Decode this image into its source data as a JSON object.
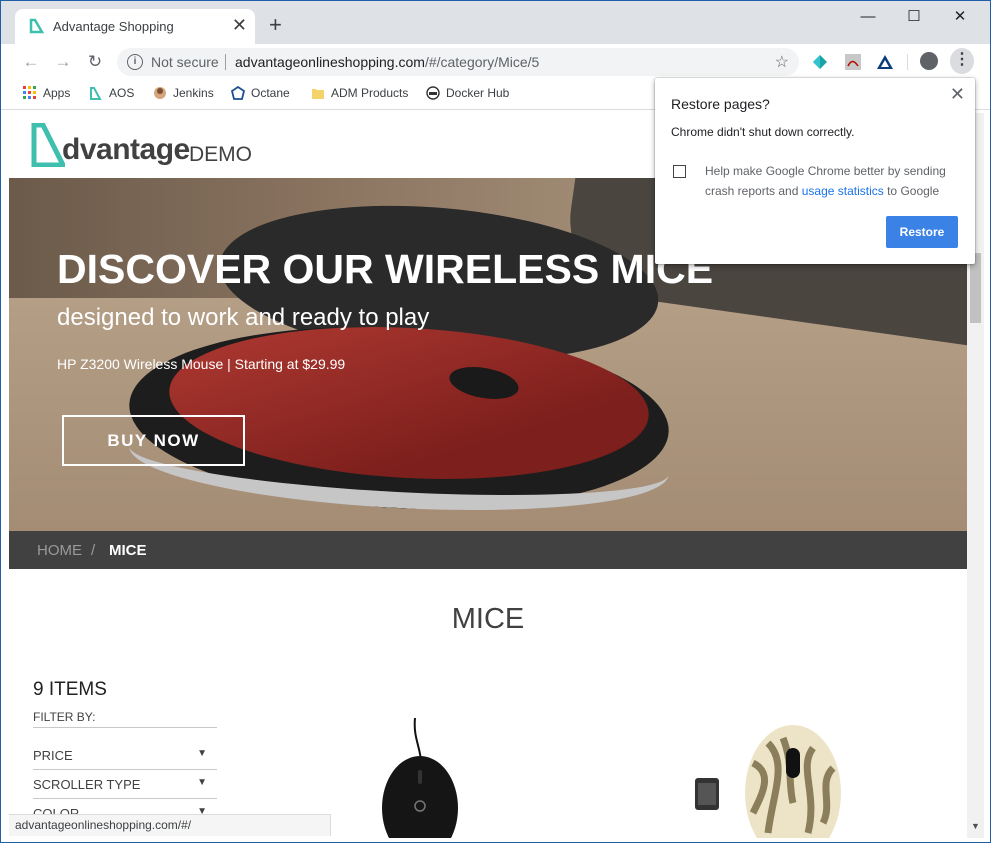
{
  "tab": {
    "title": "Advantage Shopping",
    "close": "✕",
    "new_tab": "+"
  },
  "window_controls": {
    "minimize": "—",
    "maximize": "☐",
    "close": "✕"
  },
  "toolbar": {
    "back": "←",
    "forward": "→",
    "reload": "↻",
    "security_label": "Not secure",
    "url_host": "advantageonlineshopping.com",
    "url_path": "/#/category/Mice/5",
    "star": "☆",
    "menu": "⋮"
  },
  "bookmarks": [
    {
      "label": "Apps",
      "icon": "apps-grid-icon"
    },
    {
      "label": "AOS",
      "icon": "aos-icon"
    },
    {
      "label": "Jenkins",
      "icon": "jenkins-icon"
    },
    {
      "label": "Octane",
      "icon": "octane-icon"
    },
    {
      "label": "ADM Products",
      "icon": "folder-icon"
    },
    {
      "label": "Docker Hub",
      "icon": "docker-icon"
    }
  ],
  "site": {
    "logo_text": "dvantage",
    "logo_demo": "DEMO",
    "hero": {
      "title": "DISCOVER OUR WIRELESS MICE",
      "subtitle": "designed to work and ready to play",
      "tagline": "HP Z3200 Wireless Mouse | Starting at $29.99",
      "cta": "BUY NOW"
    },
    "breadcrumb": {
      "home": "HOME",
      "separator": "/",
      "current": "MICE"
    },
    "category_title": "MICE",
    "items_count": "9 ITEMS",
    "filter_by": "FILTER BY:",
    "filters": [
      "PRICE",
      "SCROLLER TYPE",
      "COLOR"
    ],
    "filter_arrow": "▼"
  },
  "status_bar": "advantageonlineshopping.com/#/",
  "popup": {
    "title": "Restore pages?",
    "close": "✕",
    "message": "Chrome didn't shut down correctly.",
    "help_before": "Help make Google Chrome better by sending crash reports and ",
    "help_link": "usage statistics",
    "help_after": " to Google",
    "button": "Restore"
  },
  "colors": {
    "accent_teal": "#3fbfae",
    "restore_blue": "#3b82e7",
    "breadcrumb_bg": "#414141"
  }
}
